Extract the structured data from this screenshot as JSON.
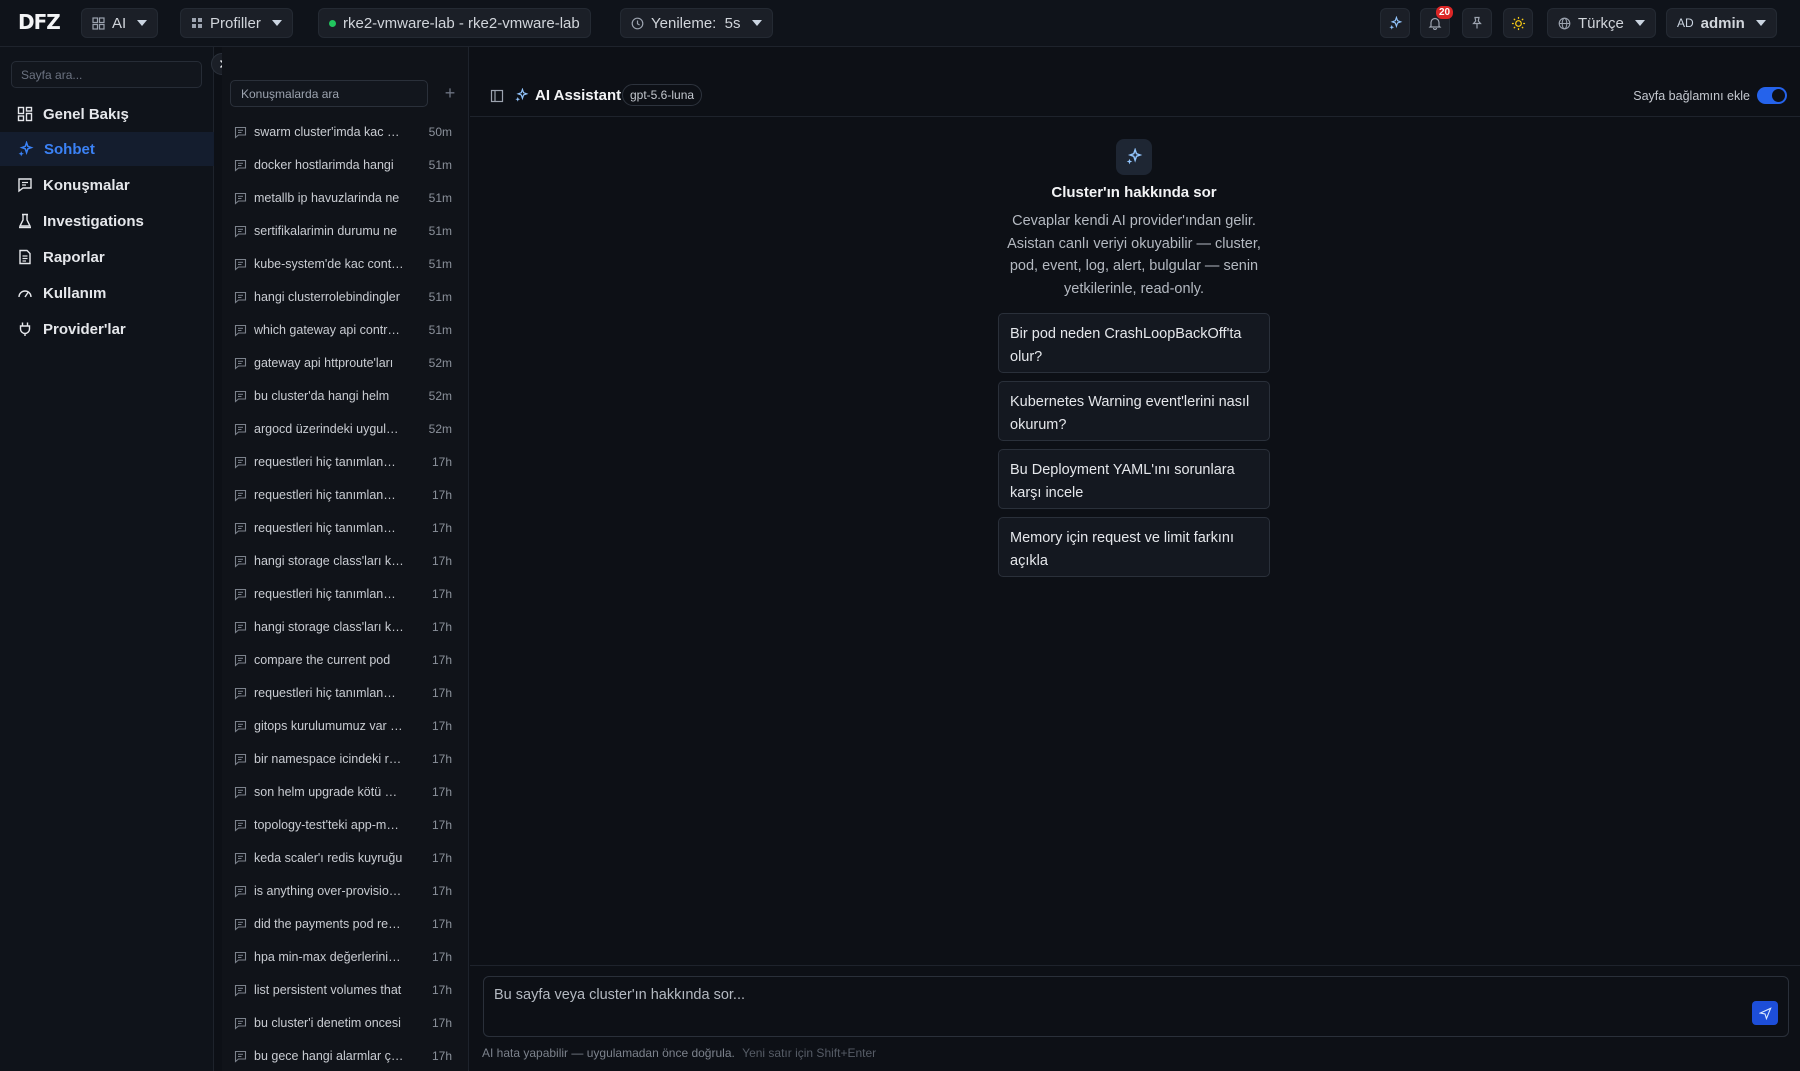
{
  "topbar": {
    "logo": "DFZ",
    "ai_menu": "AI",
    "profiles_menu": "Profiller",
    "cluster": "rke2-vmware-lab - rke2-vmware-lab",
    "refresh": "Yenileme:  5s",
    "notification_count": "20",
    "language": "Türkçe",
    "user_initials": "AD",
    "user_name": "admin"
  },
  "sidebar": {
    "search_placeholder": "Sayfa ara...",
    "items": [
      {
        "label": "Genel Bakış",
        "icon": "dashboard-icon"
      },
      {
        "label": "Sohbet",
        "icon": "sparkles-icon",
        "active": true
      },
      {
        "label": "Konuşmalar",
        "icon": "message-icon"
      },
      {
        "label": "Investigations",
        "icon": "investigation-icon"
      },
      {
        "label": "Raporlar",
        "icon": "report-icon"
      },
      {
        "label": "Kullanım",
        "icon": "gauge-icon"
      },
      {
        "label": "Provider'lar",
        "icon": "plug-icon"
      }
    ]
  },
  "conversations": {
    "search_placeholder": "Konuşmalarda ara",
    "add_label": "+",
    "items": [
      {
        "title": "swarm cluster'imda kac servis",
        "time": "50m"
      },
      {
        "title": "docker hostlarimda hangi",
        "time": "51m"
      },
      {
        "title": "metallb ip havuzlarinda ne",
        "time": "51m"
      },
      {
        "title": "sertifikalarimin durumu ne",
        "time": "51m"
      },
      {
        "title": "kube-system'de kac container",
        "time": "51m"
      },
      {
        "title": "hangi clusterrolebindingler",
        "time": "51m"
      },
      {
        "title": "which gateway api controller",
        "time": "51m"
      },
      {
        "title": "gateway api httproute'ları",
        "time": "52m"
      },
      {
        "title": "bu cluster'da hangi helm",
        "time": "52m"
      },
      {
        "title": "argocd üzerindeki uygulamalar",
        "time": "52m"
      },
      {
        "title": "requestleri hiç tanımlanmamış",
        "time": "17h"
      },
      {
        "title": "requestleri hiç tanımlanmamış",
        "time": "17h"
      },
      {
        "title": "requestleri hiç tanımlanmamış",
        "time": "17h"
      },
      {
        "title": "hangi storage class'ları kullanılıyor",
        "time": "17h"
      },
      {
        "title": "requestleri hiç tanımlanmamış",
        "time": "17h"
      },
      {
        "title": "hangi storage class'ları kullanılıyor",
        "time": "17h"
      },
      {
        "title": "compare the current pod",
        "time": "17h"
      },
      {
        "title": "requestleri hiç tanımlanmamış",
        "time": "17h"
      },
      {
        "title": "gitops kurulumumuz var mı",
        "time": "17h"
      },
      {
        "title": "bir namespace icindeki resource",
        "time": "17h"
      },
      {
        "title": "son helm upgrade kötü oldu",
        "time": "17h"
      },
      {
        "title": "topology-test'teki app-mesh",
        "time": "17h"
      },
      {
        "title": "keda scaler'ı redis kuyruğu",
        "time": "17h"
      },
      {
        "title": "is anything over-provisioned",
        "time": "17h"
      },
      {
        "title": "did the payments pod restart",
        "time": "17h"
      },
      {
        "title": "hpa min-max değerlerini göster",
        "time": "17h"
      },
      {
        "title": "list persistent volumes that",
        "time": "17h"
      },
      {
        "title": "bu cluster'i denetim oncesi",
        "time": "17h"
      },
      {
        "title": "bu gece hangi alarmlar çaldı",
        "time": "17h"
      }
    ]
  },
  "main": {
    "title": "AI Assistant",
    "model": "gpt-5.6-luna",
    "context_label": "Sayfa bağlamını ekle",
    "hero_title": "Cluster'ın hakkında sor",
    "hero_desc": "Cevaplar kendi AI provider'ından gelir. Asistan canlı veriyi okuyabilir — cluster, pod, event, log, alert, bulgular — senin yetkilerinle, read-only.",
    "suggestions": [
      "Bir pod neden CrashLoopBackOff'ta olur?",
      "Kubernetes Warning event'lerini nasıl okurum?",
      "Bu Deployment YAML'ını sorunlara karşı incele",
      "Memory için request ve limit farkını açıkla"
    ],
    "composer_placeholder": "Bu sayfa veya cluster'ın hakkında sor...",
    "disclaimer": "AI hata yapabilir — uygulamadan önce doğrula.",
    "hint": "Yeni satır için Shift+Enter"
  },
  "colors": {
    "accent": "#3b82f6",
    "background": "#0d1016",
    "status_green": "#22c55e",
    "badge_red": "#dc2626"
  }
}
